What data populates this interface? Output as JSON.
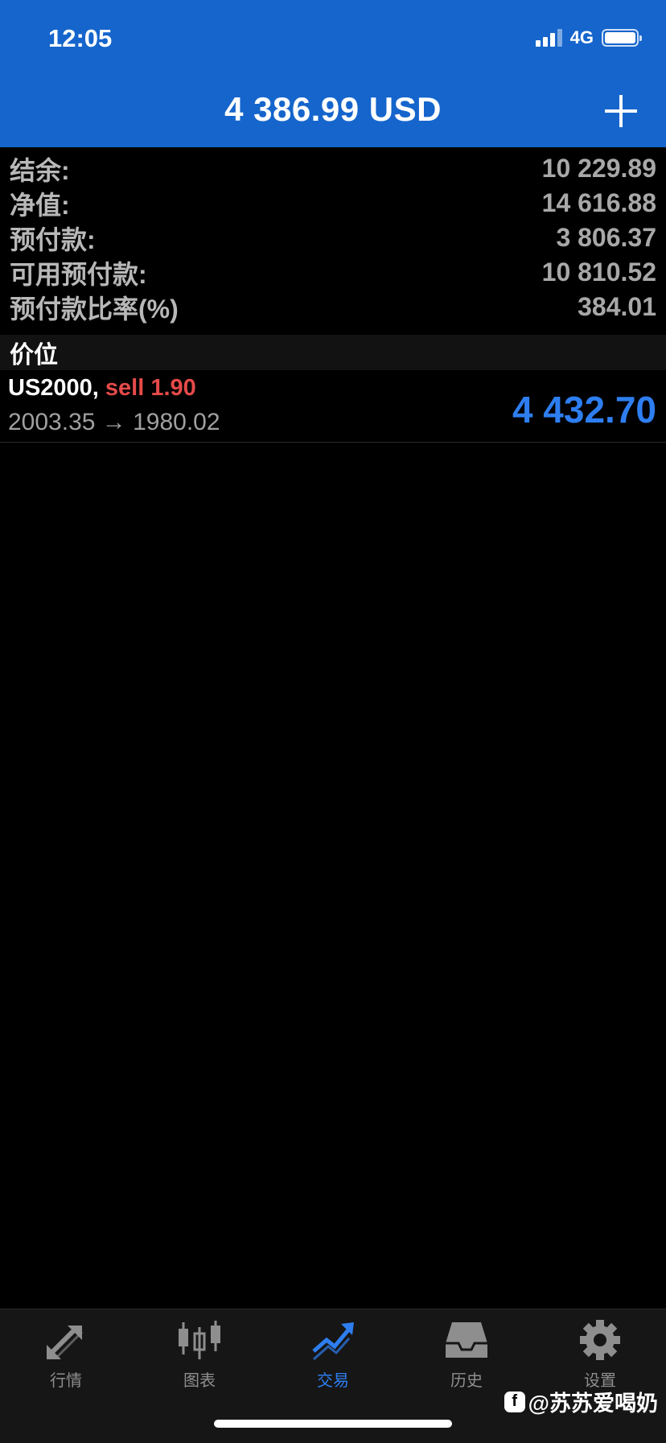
{
  "status_bar": {
    "time": "12:05",
    "network": "4G"
  },
  "header": {
    "title": "4 386.99 USD",
    "add_icon": "plus-icon"
  },
  "summary": {
    "rows": [
      {
        "label": "结余:",
        "value": "10 229.89"
      },
      {
        "label": "净值:",
        "value": "14 616.88"
      },
      {
        "label": "预付款:",
        "value": "3 806.37"
      },
      {
        "label": "可用预付款:",
        "value": "10 810.52"
      },
      {
        "label": "预付款比率(%)",
        "value": "384.01"
      }
    ]
  },
  "positions": {
    "section_title": "价位",
    "items": [
      {
        "symbol": "US2000,",
        "side": "sell 1.90",
        "price_range": "2003.35 → 1980.02",
        "profit": "4 432.70"
      }
    ]
  },
  "tabbar": {
    "tabs": [
      {
        "label": "行情",
        "icon": "quotes-arrows-icon",
        "active": false
      },
      {
        "label": "图表",
        "icon": "candlestick-chart-icon",
        "active": false
      },
      {
        "label": "交易",
        "icon": "trade-trend-icon",
        "active": true
      },
      {
        "label": "历史",
        "icon": "history-inbox-icon",
        "active": false
      },
      {
        "label": "设置",
        "icon": "gear-icon",
        "active": false
      }
    ]
  },
  "watermark": {
    "text": "@苏苏爱喝奶",
    "icon_glyph": "f"
  },
  "colors": {
    "header_bg": "#1565cc",
    "profit_blue": "#2e7ef0",
    "sell_red": "#e64a4a"
  }
}
